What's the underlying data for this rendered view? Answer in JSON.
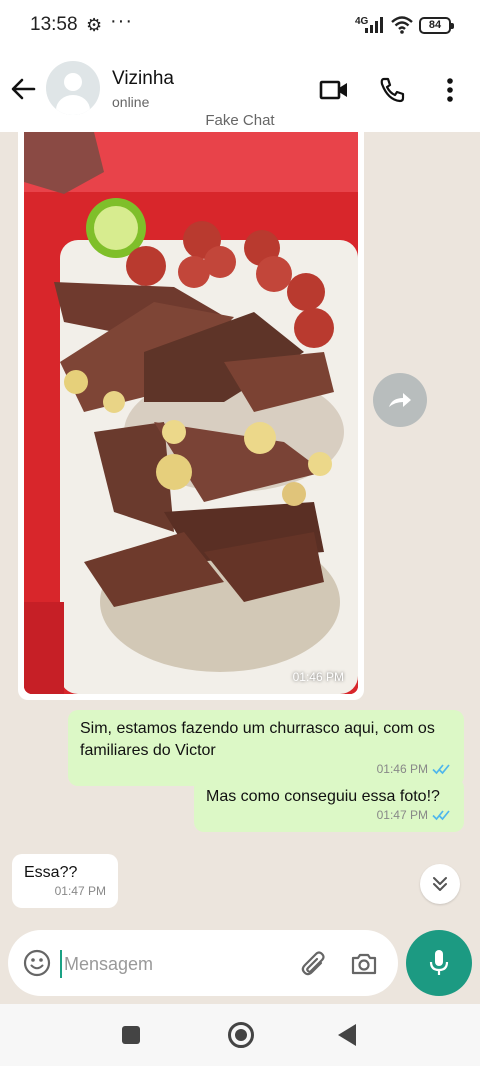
{
  "status_bar": {
    "time": "13:58",
    "network": "4G",
    "battery": "84"
  },
  "header": {
    "contact_name": "Vizinha",
    "contact_status": "online",
    "subtitle": "Fake Chat"
  },
  "messages": [
    {
      "type": "image",
      "direction": "incoming",
      "time": "01:46 PM"
    },
    {
      "type": "text",
      "direction": "outgoing",
      "text": "Sim, estamos fazendo um churrasco aqui, com os familiares do Victor",
      "time": "01:46 PM",
      "status": "read"
    },
    {
      "type": "text",
      "direction": "outgoing",
      "text": "Mas como conseguiu essa foto!?",
      "time": "01:47 PM",
      "status": "read"
    },
    {
      "type": "text",
      "direction": "incoming",
      "text": "Essa??",
      "time": "01:47 PM"
    }
  ],
  "input": {
    "placeholder": "Mensagem",
    "value": ""
  },
  "colors": {
    "accent": "#1c9a82",
    "outgoing_bubble": "#dcf8c6",
    "incoming_bubble": "#ffffff",
    "chat_background": "#ece5dd",
    "read_ticks": "#4fb6ec"
  },
  "icons": {
    "back": "arrow-left-icon",
    "video": "video-camera-icon",
    "call": "phone-icon",
    "menu": "kebab-menu-icon",
    "forward": "forward-icon",
    "scroll_down": "double-chevron-down-icon",
    "emoji": "emoji-icon",
    "attach": "paperclip-icon",
    "camera": "camera-icon",
    "mic": "microphone-icon"
  }
}
